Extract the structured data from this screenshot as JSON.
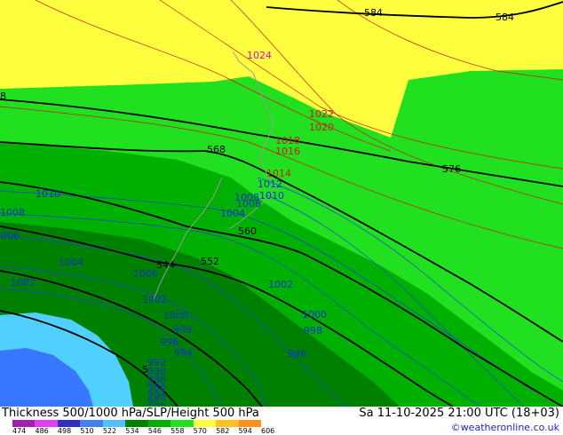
{
  "map": {
    "pressure_labels": [
      {
        "text": "1024",
        "color": "magenta"
      },
      {
        "text": "1022",
        "color": "red"
      },
      {
        "text": "1020",
        "color": "red"
      },
      {
        "text": "1018",
        "color": "red"
      },
      {
        "text": "1016",
        "color": "red"
      },
      {
        "text": "1014",
        "color": "red"
      },
      {
        "text": "1012",
        "color": "blue"
      },
      {
        "text": "1010",
        "color": "blue"
      },
      {
        "text": "1008",
        "color": "blue"
      },
      {
        "text": "1006",
        "color": "blue"
      },
      {
        "text": "1004",
        "color": "blue"
      },
      {
        "text": "1010",
        "color": "blue"
      },
      {
        "text": "1008",
        "color": "blue"
      },
      {
        "text": "1006",
        "color": "blue"
      },
      {
        "text": "1004",
        "color": "blue"
      },
      {
        "text": "1006",
        "color": "blue"
      },
      {
        "text": "1002",
        "color": "blue"
      },
      {
        "text": "1002",
        "color": "blue"
      },
      {
        "text": "1002",
        "color": "blue"
      },
      {
        "text": "1000",
        "color": "blue"
      },
      {
        "text": "1000",
        "color": "blue"
      },
      {
        "text": "998",
        "color": "blue"
      },
      {
        "text": "998",
        "color": "blue"
      },
      {
        "text": "996",
        "color": "blue"
      },
      {
        "text": "996",
        "color": "blue"
      },
      {
        "text": "994",
        "color": "blue"
      },
      {
        "text": "992",
        "color": "blue"
      },
      {
        "text": "990",
        "color": "blue"
      },
      {
        "text": "988",
        "color": "blue"
      },
      {
        "text": "986",
        "color": "blue"
      },
      {
        "text": "984",
        "color": "blue"
      },
      {
        "text": "982",
        "color": "blue"
      }
    ],
    "height_labels": [
      "584",
      "584",
      "576",
      "568",
      "560",
      "552",
      "544",
      "5",
      "8"
    ],
    "colors": {
      "yellow": "#ffff40",
      "light_green": "#20e020",
      "green": "#00b000",
      "dark_green": "#008000",
      "cyan": "#50d0ff",
      "blue": "#3878ff"
    }
  },
  "footer": {
    "title": "Thickness 500/1000 hPa/SLP/Height 500 hPa",
    "datetime": "Sa 11-10-2025 21:00 UTC (18+03)",
    "credit": "©weatheronline.co.uk",
    "legend": {
      "ticks": [
        "474",
        "486",
        "498",
        "510",
        "522",
        "534",
        "546",
        "558",
        "570",
        "582",
        "594",
        "606"
      ],
      "colors": [
        "#a020b0",
        "#e040f0",
        "#3030c0",
        "#4080f0",
        "#50c0ff",
        "#008000",
        "#00b000",
        "#20e020",
        "#ffff40",
        "#ffc020",
        "#ff9020"
      ]
    }
  }
}
